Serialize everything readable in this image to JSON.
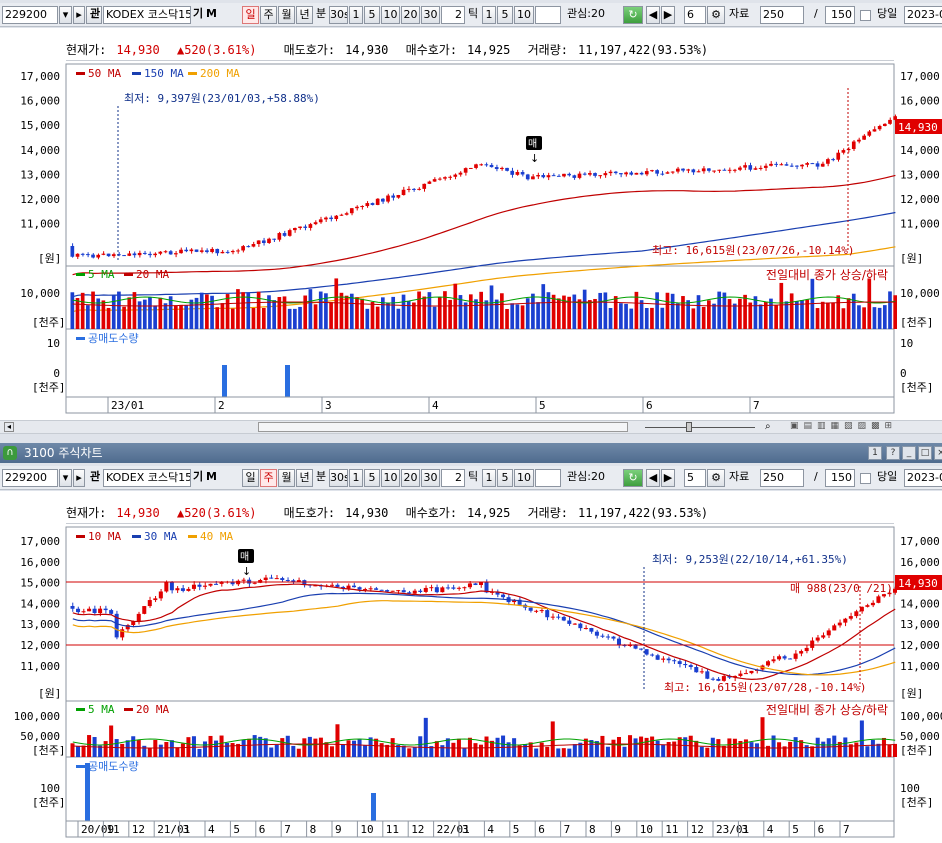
{
  "toolbar": {
    "code": "229200",
    "name": "KODEX 코스닥15",
    "f_gi": "기",
    "f_m": "M",
    "fav": "관",
    "periods": [
      "일",
      "주",
      "월",
      "년",
      "분"
    ],
    "periods_sel": "일",
    "mins": [
      "30s",
      "1",
      "5",
      "10",
      "20",
      "30"
    ],
    "tick_label": "틱",
    "tick_btns": [
      "1",
      "5",
      "10"
    ],
    "gwansim": "관심:20",
    "count_label": "자료",
    "count": "250",
    "slash": "/",
    "count2": "150",
    "dangil": "당일",
    "date": "2023-0"
  },
  "toolbar2": {
    "periods_sel": "주",
    "spin": "5",
    "gwansim": "관심:20",
    "spin_top": "6",
    "tick_val2": "2",
    "tick_val": "2"
  },
  "info": {
    "price_label": "현재가:",
    "price": "14,930",
    "change": "520(3.61%)",
    "ask_label": "매도호가:",
    "ask": "14,930",
    "bid_label": "매수호가:",
    "bid": "14,925",
    "vol_label": "거래량:",
    "vol": "11,197,422(93.53%)"
  },
  "chart_top": {
    "price_axis": [
      "17,000",
      "16,000",
      "15,000",
      "14,000",
      "13,000",
      "12,000",
      "11,000"
    ],
    "unit_won": "[원]",
    "legend": [
      "50 MA",
      "150 MA",
      "200 MA"
    ],
    "low_note": "최저: 9,397원(23/01/03,+58.88%)",
    "high_note": "최고: 16,615원(23/07/26,-10.14%)",
    "last_price": "14,930",
    "sell_mark": "매",
    "vol_legend": [
      "5 MA",
      "20 MA"
    ],
    "vol_axis": "10,000",
    "vol_unit": "[천주]",
    "vol_note": "전일대비 종가 상승/하락",
    "short_legend": "공매도수량",
    "short_axis": [
      "10",
      "0"
    ],
    "short_unit": "[천주]",
    "x_labels": [
      "23/01",
      "2",
      "3",
      "4",
      "5",
      "6",
      "7"
    ]
  },
  "chart_bottom": {
    "price_axis": [
      "17,000",
      "16,000",
      "15,000",
      "14,000",
      "13,000",
      "12,000",
      "11,000"
    ],
    "unit_won": "[원]",
    "legend": [
      "10 MA",
      "30 MA",
      "40 MA"
    ],
    "low_note": "최저: 9,253원(22/10/14,+61.35%)",
    "high_note": "최고: 16,615원(23/07/28,-10.14%)",
    "mid_note": "매 988(23/0 /21)",
    "last_price": "14,930",
    "sell_mark": "매",
    "vol_legend": [
      "5 MA",
      "20 MA"
    ],
    "vol_axis": [
      "100,000",
      "50,000"
    ],
    "vol_unit": "[천주]",
    "vol_note": "전일대비 종가 상승/하락",
    "short_legend": "공매도수량",
    "short_axis": "100",
    "short_unit": "[천주]",
    "x_labels": [
      "20/09",
      "11",
      "12",
      "21/01",
      "3",
      "4",
      "5",
      "6",
      "7",
      "8",
      "9",
      "10",
      "11",
      "12",
      "22/01",
      "3",
      "4",
      "5",
      "6",
      "7",
      "8",
      "9",
      "10",
      "11",
      "12",
      "23/01",
      "3",
      "4",
      "5",
      "6",
      "7"
    ]
  },
  "window_title": "3100 주식차트",
  "colors": {
    "up": "#e00000",
    "down": "#1a3fd0",
    "ma1": "#c00000",
    "ma2": "#1a3fb0",
    "ma3": "#f0a000",
    "green": "#00a000"
  }
}
